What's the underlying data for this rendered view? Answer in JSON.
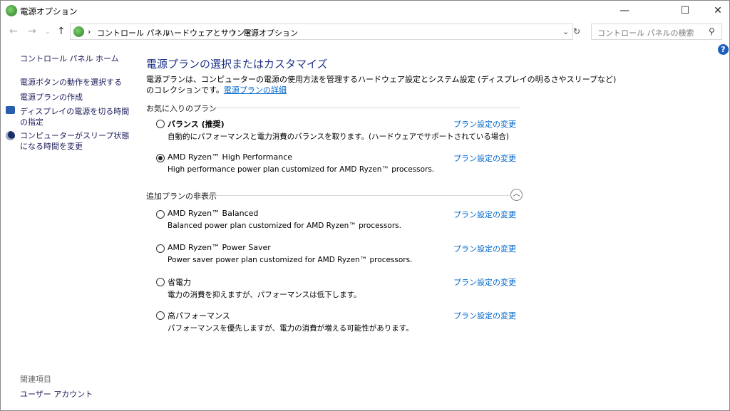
{
  "window": {
    "title": "電源オプション",
    "minimize": "—",
    "maximize": "☐",
    "close": "✕"
  },
  "address": {
    "path": [
      "コントロール パネル",
      "ハードウェアとサウンド",
      "電源オプション"
    ],
    "search_placeholder": "コントロール パネルの検索"
  },
  "sidebar": {
    "home": "コントロール パネル ホーム",
    "items": [
      "電源ボタンの動作を選択する",
      "電源プランの作成",
      "ディスプレイの電源を切る時間の指定",
      "コンピューターがスリープ状態になる時間を変更"
    ],
    "related_heading": "関連項目",
    "related": [
      "ユーザー アカウント"
    ]
  },
  "main": {
    "title": "電源プランの選択またはカスタマイズ",
    "desc_line1": "電源プランは、コンピューターの電源の使用方法を管理するハードウェア設定とシステム設定 (ディスプレイの明るさやスリープなど)",
    "desc_line2": "のコレクションです。",
    "desc_link": "電源プランの詳細",
    "favorites_label": "お気に入りのプラン",
    "hidden_label": "追加プランの非表示",
    "change_label": "プラン設定の変更",
    "favorites": [
      {
        "name": "バランス (推奨)",
        "desc": "自動的にパフォーマンスと電力消費のバランスを取ります。(ハードウェアでサポートされている場合)",
        "selected": false
      },
      {
        "name": "AMD Ryzen™ High Performance",
        "desc": "High performance power plan customized for AMD Ryzen™ processors.",
        "selected": true
      }
    ],
    "additional": [
      {
        "name": "AMD Ryzen™ Balanced",
        "desc": "Balanced power plan customized for AMD Ryzen™ processors.",
        "selected": false
      },
      {
        "name": "AMD Ryzen™ Power Saver",
        "desc": "Power saver power plan customized for AMD Ryzen™ processors.",
        "selected": false
      },
      {
        "name": "省電力",
        "desc": "電力の消費を抑えますが、パフォーマンスは低下します。",
        "selected": false
      },
      {
        "name": "高パフォーマンス",
        "desc": "パフォーマンスを優先しますが、電力の消費が増える可能性があります。",
        "selected": false
      }
    ]
  },
  "colors": {
    "link": "#0066cc",
    "heading": "#1e3287"
  }
}
